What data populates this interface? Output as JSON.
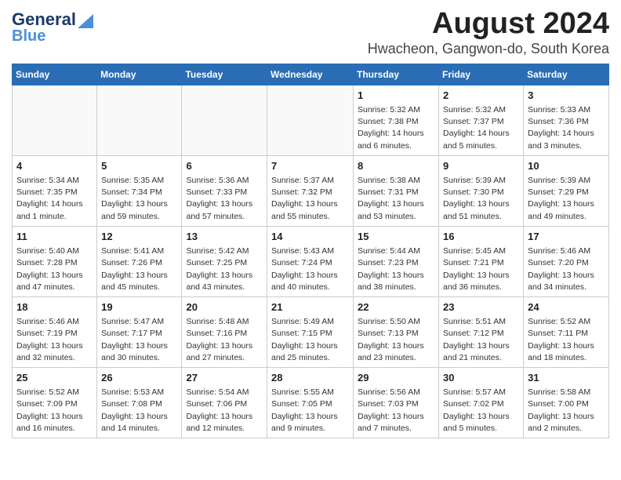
{
  "header": {
    "logo_line1": "General",
    "logo_line2": "Blue",
    "title": "August 2024",
    "subtitle": "Hwacheon, Gangwon-do, South Korea"
  },
  "weekdays": [
    "Sunday",
    "Monday",
    "Tuesday",
    "Wednesday",
    "Thursday",
    "Friday",
    "Saturday"
  ],
  "weeks": [
    [
      {
        "day": "",
        "info": ""
      },
      {
        "day": "",
        "info": ""
      },
      {
        "day": "",
        "info": ""
      },
      {
        "day": "",
        "info": ""
      },
      {
        "day": "1",
        "info": "Sunrise: 5:32 AM\nSunset: 7:38 PM\nDaylight: 14 hours\nand 6 minutes."
      },
      {
        "day": "2",
        "info": "Sunrise: 5:32 AM\nSunset: 7:37 PM\nDaylight: 14 hours\nand 5 minutes."
      },
      {
        "day": "3",
        "info": "Sunrise: 5:33 AM\nSunset: 7:36 PM\nDaylight: 14 hours\nand 3 minutes."
      }
    ],
    [
      {
        "day": "4",
        "info": "Sunrise: 5:34 AM\nSunset: 7:35 PM\nDaylight: 14 hours\nand 1 minute."
      },
      {
        "day": "5",
        "info": "Sunrise: 5:35 AM\nSunset: 7:34 PM\nDaylight: 13 hours\nand 59 minutes."
      },
      {
        "day": "6",
        "info": "Sunrise: 5:36 AM\nSunset: 7:33 PM\nDaylight: 13 hours\nand 57 minutes."
      },
      {
        "day": "7",
        "info": "Sunrise: 5:37 AM\nSunset: 7:32 PM\nDaylight: 13 hours\nand 55 minutes."
      },
      {
        "day": "8",
        "info": "Sunrise: 5:38 AM\nSunset: 7:31 PM\nDaylight: 13 hours\nand 53 minutes."
      },
      {
        "day": "9",
        "info": "Sunrise: 5:39 AM\nSunset: 7:30 PM\nDaylight: 13 hours\nand 51 minutes."
      },
      {
        "day": "10",
        "info": "Sunrise: 5:39 AM\nSunset: 7:29 PM\nDaylight: 13 hours\nand 49 minutes."
      }
    ],
    [
      {
        "day": "11",
        "info": "Sunrise: 5:40 AM\nSunset: 7:28 PM\nDaylight: 13 hours\nand 47 minutes."
      },
      {
        "day": "12",
        "info": "Sunrise: 5:41 AM\nSunset: 7:26 PM\nDaylight: 13 hours\nand 45 minutes."
      },
      {
        "day": "13",
        "info": "Sunrise: 5:42 AM\nSunset: 7:25 PM\nDaylight: 13 hours\nand 43 minutes."
      },
      {
        "day": "14",
        "info": "Sunrise: 5:43 AM\nSunset: 7:24 PM\nDaylight: 13 hours\nand 40 minutes."
      },
      {
        "day": "15",
        "info": "Sunrise: 5:44 AM\nSunset: 7:23 PM\nDaylight: 13 hours\nand 38 minutes."
      },
      {
        "day": "16",
        "info": "Sunrise: 5:45 AM\nSunset: 7:21 PM\nDaylight: 13 hours\nand 36 minutes."
      },
      {
        "day": "17",
        "info": "Sunrise: 5:46 AM\nSunset: 7:20 PM\nDaylight: 13 hours\nand 34 minutes."
      }
    ],
    [
      {
        "day": "18",
        "info": "Sunrise: 5:46 AM\nSunset: 7:19 PM\nDaylight: 13 hours\nand 32 minutes."
      },
      {
        "day": "19",
        "info": "Sunrise: 5:47 AM\nSunset: 7:17 PM\nDaylight: 13 hours\nand 30 minutes."
      },
      {
        "day": "20",
        "info": "Sunrise: 5:48 AM\nSunset: 7:16 PM\nDaylight: 13 hours\nand 27 minutes."
      },
      {
        "day": "21",
        "info": "Sunrise: 5:49 AM\nSunset: 7:15 PM\nDaylight: 13 hours\nand 25 minutes."
      },
      {
        "day": "22",
        "info": "Sunrise: 5:50 AM\nSunset: 7:13 PM\nDaylight: 13 hours\nand 23 minutes."
      },
      {
        "day": "23",
        "info": "Sunrise: 5:51 AM\nSunset: 7:12 PM\nDaylight: 13 hours\nand 21 minutes."
      },
      {
        "day": "24",
        "info": "Sunrise: 5:52 AM\nSunset: 7:11 PM\nDaylight: 13 hours\nand 18 minutes."
      }
    ],
    [
      {
        "day": "25",
        "info": "Sunrise: 5:52 AM\nSunset: 7:09 PM\nDaylight: 13 hours\nand 16 minutes."
      },
      {
        "day": "26",
        "info": "Sunrise: 5:53 AM\nSunset: 7:08 PM\nDaylight: 13 hours\nand 14 minutes."
      },
      {
        "day": "27",
        "info": "Sunrise: 5:54 AM\nSunset: 7:06 PM\nDaylight: 13 hours\nand 12 minutes."
      },
      {
        "day": "28",
        "info": "Sunrise: 5:55 AM\nSunset: 7:05 PM\nDaylight: 13 hours\nand 9 minutes."
      },
      {
        "day": "29",
        "info": "Sunrise: 5:56 AM\nSunset: 7:03 PM\nDaylight: 13 hours\nand 7 minutes."
      },
      {
        "day": "30",
        "info": "Sunrise: 5:57 AM\nSunset: 7:02 PM\nDaylight: 13 hours\nand 5 minutes."
      },
      {
        "day": "31",
        "info": "Sunrise: 5:58 AM\nSunset: 7:00 PM\nDaylight: 13 hours\nand 2 minutes."
      }
    ]
  ]
}
